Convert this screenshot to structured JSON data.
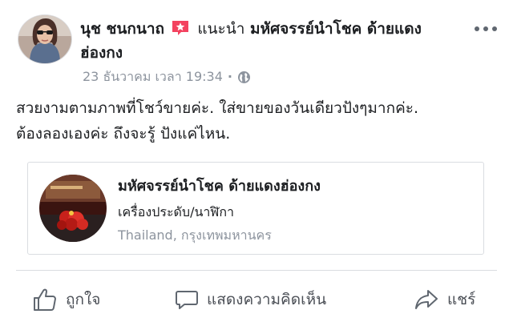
{
  "post": {
    "author": "นุช ชนกนาถ",
    "action_text": "แนะนำ",
    "page_name": "มหัศจรรย์นำโชค ด้ายแดงฮ่องกง",
    "timestamp": "23 ธันวาคม เวลา 19:34",
    "meta_separator": "·",
    "audience_icon": "globe-icon",
    "text_line_1": "สวยงามตามภาพที่โชว์ขายค่ะ. ใส่ขายของวันเดียวปังๆมากค่ะ.",
    "text_line_2": "ต้องลองเองค่ะ ถึงจะรู้ ปังแค่ไหน."
  },
  "card": {
    "name": "มหัศจรรย์นำโชค ด้ายแดงฮ่องกง",
    "category": "เครื่องประดับ/นาฬิกา",
    "location": "Thailand, กรุงเทพมหานคร"
  },
  "actions": {
    "like": "ถูกใจ",
    "comment": "แสดงความคิดเห็น",
    "share": "แชร์"
  },
  "colors": {
    "recommend_badge": "#f3425f",
    "secondary_text": "#8d949e",
    "action_text": "#4b4f56",
    "divider": "#dadde1"
  }
}
